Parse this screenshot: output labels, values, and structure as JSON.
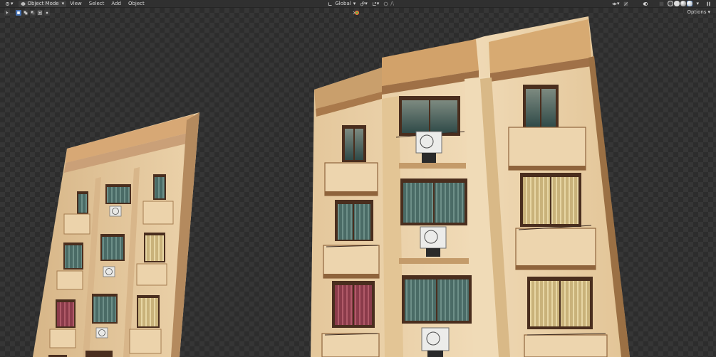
{
  "header": {
    "mode_label": "Object Mode",
    "menus": [
      "View",
      "Select",
      "Add",
      "Object"
    ],
    "orientation_label": "Global"
  },
  "toolbar": {
    "options_label": "Options"
  },
  "colors": {
    "accent": "#4772b3",
    "header_bg": "#303030",
    "wall": "#e8cfa6",
    "trim": "#c89a64",
    "window_frame": "#4a2e1e",
    "glass": "#3e5c5a",
    "curtain_red": "#8a3b4a"
  },
  "icons": [
    "editor-type-icon",
    "mode-icon",
    "orientation-icon",
    "pivot-icon",
    "snap-icon",
    "proportional-icon",
    "visibility-icon",
    "gizmo-icon",
    "overlay-icon",
    "xray-icon",
    "shading-wireframe-icon",
    "shading-solid-icon",
    "shading-material-icon",
    "shading-rendered-icon",
    "collapse-icon"
  ]
}
